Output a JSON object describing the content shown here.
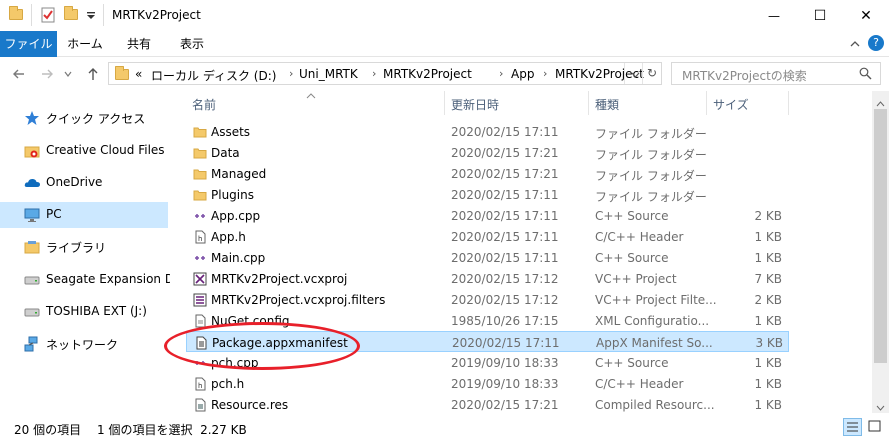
{
  "window": {
    "title": "MRTKv2Project",
    "minimize_glyph": "—",
    "maximize_glyph": "☐",
    "close_glyph": "✕"
  },
  "ribbon": {
    "tabs": [
      "ファイル",
      "ホーム",
      "共有",
      "表示"
    ],
    "active_tab": "ファイル"
  },
  "address": {
    "overflow": "«",
    "crumbs": [
      "ローカル ディスク (D:)",
      "Uni_MRTK",
      "MRTKv2Project",
      "App",
      "MRTKv2Project"
    ],
    "refresh_glyph": "↻"
  },
  "search": {
    "placeholder": "MRTKv2Projectの検索"
  },
  "nav": {
    "items": [
      {
        "label": "クイック アクセス",
        "icon": "star-icon"
      },
      {
        "label": "Creative Cloud Files",
        "icon": "creative-cloud-icon"
      },
      {
        "label": "OneDrive",
        "icon": "cloud-icon"
      },
      {
        "label": "PC",
        "icon": "pc-icon",
        "selected": true
      },
      {
        "label": "ライブラリ",
        "icon": "library-icon"
      },
      {
        "label": "Seagate Expansion Drive",
        "icon": "drive-icon"
      },
      {
        "label": "TOSHIBA EXT (J:)",
        "icon": "drive-icon"
      },
      {
        "label": "ネットワーク",
        "icon": "network-icon"
      }
    ]
  },
  "columns": {
    "name": "名前",
    "date": "更新日時",
    "type": "種類",
    "size": "サイズ"
  },
  "files": [
    {
      "name": "Assets",
      "date": "2020/02/15 17:11",
      "type": "ファイル フォルダー",
      "size": "",
      "icon": "folder-icon"
    },
    {
      "name": "Data",
      "date": "2020/02/15 17:21",
      "type": "ファイル フォルダー",
      "size": "",
      "icon": "folder-icon"
    },
    {
      "name": "Managed",
      "date": "2020/02/15 17:21",
      "type": "ファイル フォルダー",
      "size": "",
      "icon": "folder-icon"
    },
    {
      "name": "Plugins",
      "date": "2020/02/15 17:11",
      "type": "ファイル フォルダー",
      "size": "",
      "icon": "folder-icon"
    },
    {
      "name": "App.cpp",
      "date": "2020/02/15 17:11",
      "type": "C++ Source",
      "size": "2 KB",
      "icon": "cpp-file-icon"
    },
    {
      "name": "App.h",
      "date": "2020/02/15 17:11",
      "type": "C/C++ Header",
      "size": "1 KB",
      "icon": "header-file-icon"
    },
    {
      "name": "Main.cpp",
      "date": "2020/02/15 17:11",
      "type": "C++ Source",
      "size": "1 KB",
      "icon": "cpp-file-icon"
    },
    {
      "name": "MRTKv2Project.vcxproj",
      "date": "2020/02/15 17:12",
      "type": "VC++ Project",
      "size": "7 KB",
      "icon": "vcxproj-file-icon"
    },
    {
      "name": "MRTKv2Project.vcxproj.filters",
      "date": "2020/02/15 17:12",
      "type": "VC++ Project Filte...",
      "size": "2 KB",
      "icon": "filters-file-icon"
    },
    {
      "name": "NuGet.config",
      "date": "1985/10/26 17:15",
      "type": "XML Configuratio...",
      "size": "1 KB",
      "icon": "config-file-icon"
    },
    {
      "name": "Package.appxmanifest",
      "date": "2020/02/15 17:11",
      "type": "AppX Manifest So...",
      "size": "3 KB",
      "icon": "manifest-file-icon",
      "selected": true
    },
    {
      "name": "pch.cpp",
      "date": "2019/09/10 18:33",
      "type": "C++ Source",
      "size": "1 KB",
      "icon": "cpp-file-icon"
    },
    {
      "name": "pch.h",
      "date": "2019/09/10 18:33",
      "type": "C/C++ Header",
      "size": "1 KB",
      "icon": "header-file-icon"
    },
    {
      "name": "Resource.res",
      "date": "2020/02/15 17:21",
      "type": "Compiled Resourc...",
      "size": "1 KB",
      "icon": "resource-file-icon"
    }
  ],
  "status": {
    "item_count": "20 個の項目",
    "selection": "1 個の項目を選択  2.27 KB"
  },
  "colors": {
    "accent": "#1979ca",
    "selection_bg": "#cce8ff",
    "selection_border": "#99d1ff",
    "annotation": "#e8202a"
  }
}
